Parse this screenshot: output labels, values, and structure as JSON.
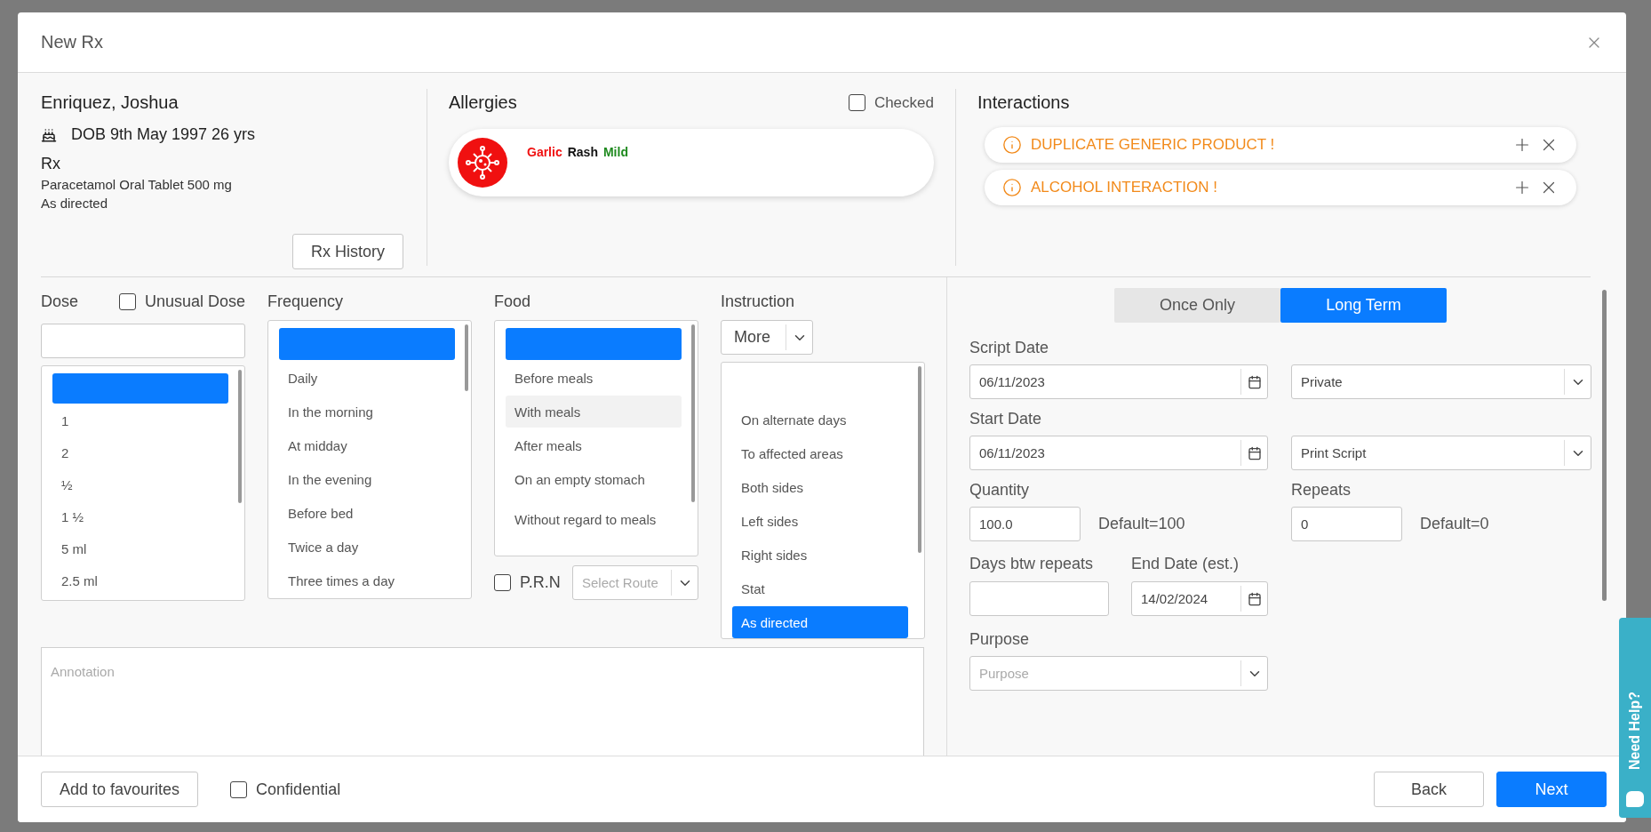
{
  "dialog": {
    "title": "New Rx"
  },
  "patient": {
    "name": "Enriquez, Joshua",
    "dob": "DOB 9th May 1997 26 yrs",
    "rx_heading": "Rx",
    "medication": "Paracetamol Oral Tablet 500 mg",
    "directions": "As directed",
    "history_button": "Rx History"
  },
  "allergies": {
    "heading": "Allergies",
    "checked_label": "Checked",
    "checked": false,
    "items": [
      {
        "substance": "Garlic",
        "reaction": "Rash",
        "severity": "Mild"
      }
    ]
  },
  "interactions": {
    "heading": "Interactions",
    "items": [
      {
        "text": "DUPLICATE GENERIC PRODUCT !"
      },
      {
        "text": "ALCOHOL INTERACTION !"
      }
    ]
  },
  "dose": {
    "heading": "Dose",
    "unusual_label": "Unusual Dose",
    "unusual": false,
    "items": [
      {
        "kind": "blank",
        "selected": true
      },
      {
        "kind": "option",
        "label": "1",
        "selected": false,
        "hovered": false
      },
      {
        "kind": "option",
        "label": "2",
        "selected": false,
        "hovered": false
      },
      {
        "kind": "option",
        "label": "½",
        "selected": false,
        "hovered": false
      },
      {
        "kind": "option",
        "label": "1 ½",
        "selected": false,
        "hovered": false
      },
      {
        "kind": "option",
        "label": "5 ml",
        "selected": false,
        "hovered": false
      },
      {
        "kind": "option",
        "label": "2.5 ml",
        "selected": false,
        "hovered": false
      }
    ]
  },
  "frequency": {
    "heading": "Frequency",
    "items": [
      {
        "kind": "blank",
        "selected": true
      },
      {
        "kind": "option",
        "label": "Daily",
        "selected": false,
        "hovered": false
      },
      {
        "kind": "option",
        "label": "In the morning",
        "selected": false,
        "hovered": false
      },
      {
        "kind": "option",
        "label": "At midday",
        "selected": false,
        "hovered": false
      },
      {
        "kind": "option",
        "label": "In the evening",
        "selected": false,
        "hovered": false
      },
      {
        "kind": "option",
        "label": "Before bed",
        "selected": false,
        "hovered": false
      },
      {
        "kind": "option",
        "label": "Twice a day",
        "selected": false,
        "hovered": false
      },
      {
        "kind": "option",
        "label": "Three times a day",
        "selected": false,
        "hovered": false
      }
    ]
  },
  "food": {
    "heading": "Food",
    "items": [
      {
        "kind": "blank",
        "selected": true
      },
      {
        "kind": "option",
        "label": "Before meals",
        "selected": false,
        "hovered": false
      },
      {
        "kind": "option",
        "label": "With meals",
        "selected": false,
        "hovered": true
      },
      {
        "kind": "option",
        "label": "After meals",
        "selected": false,
        "hovered": false
      },
      {
        "kind": "option",
        "label": "On an empty stomach",
        "selected": false,
        "hovered": false
      },
      {
        "kind": "option",
        "label": "Without regard to meals",
        "selected": false,
        "hovered": false
      }
    ],
    "prn_label": "P.R.N",
    "prn": false,
    "route_placeholder": "Select Route"
  },
  "instruction": {
    "heading": "Instruction",
    "more_button": "More",
    "items": [
      {
        "kind": "blank",
        "selected": false
      },
      {
        "kind": "option",
        "label": "On alternate days",
        "selected": false,
        "hovered": false
      },
      {
        "kind": "option",
        "label": "To affected areas",
        "selected": false,
        "hovered": false
      },
      {
        "kind": "option",
        "label": "Both sides",
        "selected": false,
        "hovered": false
      },
      {
        "kind": "option",
        "label": "Left sides",
        "selected": false,
        "hovered": false
      },
      {
        "kind": "option",
        "label": "Right sides",
        "selected": false,
        "hovered": false
      },
      {
        "kind": "option",
        "label": "Stat",
        "selected": false,
        "hovered": false
      },
      {
        "kind": "option",
        "label": "As directed",
        "selected": true,
        "hovered": false
      }
    ]
  },
  "annotation": {
    "placeholder": "Annotation"
  },
  "term_options": [
    {
      "label": "Once Only",
      "selected": false
    },
    {
      "label": "Long Term",
      "selected": true
    }
  ],
  "script_date": {
    "label": "Script Date",
    "value": "06/11/2023"
  },
  "payment": {
    "value": "Private"
  },
  "start_date": {
    "label": "Start Date",
    "value": "06/11/2023"
  },
  "script_output": {
    "value": "Print Script"
  },
  "quantity": {
    "label": "Quantity",
    "value": "100.0",
    "default_note": "Default=100"
  },
  "repeats": {
    "label": "Repeats",
    "value": "0",
    "default_note": "Default=0"
  },
  "days_between": {
    "label": "Days btw repeats"
  },
  "end_date": {
    "label": "End Date (est.)",
    "value": "14/02/2024"
  },
  "purpose": {
    "label": "Purpose",
    "placeholder": "Purpose"
  },
  "footer": {
    "favourites_button": "Add to favourites",
    "confidential_label": "Confidential",
    "confidential": false,
    "back_button": "Back",
    "next_button": "Next"
  },
  "help_tab": {
    "label": "Need Help?"
  }
}
